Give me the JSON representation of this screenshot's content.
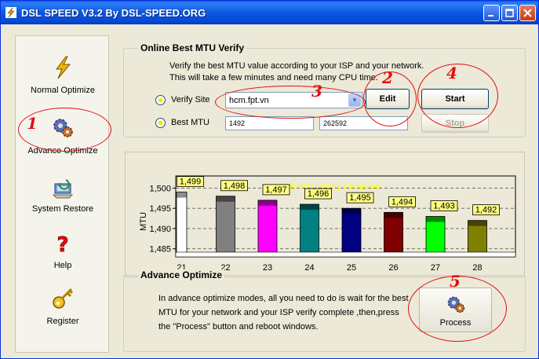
{
  "window": {
    "title": "DSL SPEED V3.2 By DSL-SPEED.ORG"
  },
  "sidebar": {
    "items": [
      {
        "label": "Normal Optimize",
        "icon": "lightning-icon"
      },
      {
        "label": "Advance Optimize",
        "icon": "gears-icon"
      },
      {
        "label": "System Restore",
        "icon": "system-restore-icon"
      },
      {
        "label": "Help",
        "icon": "question-icon"
      },
      {
        "label": "Register",
        "icon": "key-icon"
      }
    ]
  },
  "mtu_verify": {
    "title": "Online Best MTU Verify",
    "desc_line1": "Verify the best MTU value according to your ISP and your network.",
    "desc_line2": "This will take a few minutes and need many CPU time.",
    "verify_site_label": "Verify Site",
    "verify_site_value": "hcm.fpt.vn",
    "best_mtu_label": "Best MTU",
    "best_mtu_value": "1492",
    "best_mtu_value2": "262592",
    "edit_label": "Edit",
    "start_label": "Start",
    "stop_label": "Stop"
  },
  "chart_data": {
    "type": "bar",
    "title": "Best MTU Verify Complete",
    "ylabel": "MTU",
    "ylim": [
      1483,
      1503
    ],
    "yticks": [
      "1,500",
      "1,495",
      "1,490",
      "1,485"
    ],
    "categories": [
      "21",
      "22",
      "23",
      "24",
      "25",
      "26",
      "27",
      "28"
    ],
    "values": [
      1499,
      1498,
      1497,
      1496,
      1495,
      1494,
      1493,
      1492
    ],
    "value_labels": [
      "1,499",
      "1,498",
      "1,497",
      "1,496",
      "1,495",
      "1,494",
      "1,493",
      "1,492"
    ],
    "colors": [
      "#ffffff",
      "#808080",
      "#ff00ff",
      "#008080",
      "#000080",
      "#800000",
      "#00ff00",
      "#808000"
    ]
  },
  "advance": {
    "title": "Advance Optimize",
    "desc_line1": "In advance optimize modes, all you need to do is wait for the best",
    "desc_line2": "MTU for your network and your ISP verify complete ,then,press",
    "desc_line3": "the \"Process\" button and reboot windows.",
    "process_label": "Process"
  },
  "annotations": [
    "1",
    "2",
    "3",
    "4",
    "5"
  ],
  "colors": {
    "titlebar": "#0a58e0",
    "annotation": "#e01010",
    "chart_title": "#ffff00"
  }
}
